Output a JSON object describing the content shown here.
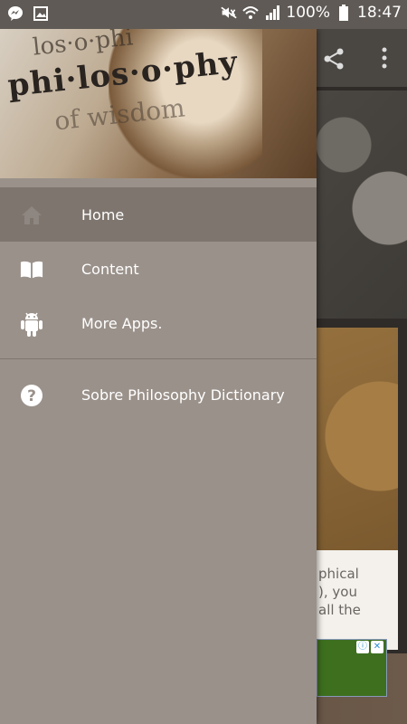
{
  "status_bar": {
    "battery": "100%",
    "time": "18:47",
    "left_icons": [
      "messenger-icon",
      "gallery-icon"
    ],
    "right_icons": [
      "mute-icon",
      "wifi-icon",
      "signal-icon",
      "battery-icon"
    ]
  },
  "background_app": {
    "text_fragment": "phical\n), you\nall the",
    "ad_badges": [
      "ⓘ",
      "✕"
    ]
  },
  "drawer": {
    "header_text_main": "phi·los·o·phy",
    "header_text_top": "los·o·phi",
    "header_text_bottom": "of wisdom",
    "menu": [
      {
        "label": "Home",
        "icon": "home-icon",
        "active": true
      },
      {
        "label": "Content",
        "icon": "book-icon",
        "active": false
      },
      {
        "label": "More Apps.",
        "icon": "android-icon",
        "active": false
      }
    ],
    "about": {
      "label": "Sobre Philosophy Dictionary",
      "icon": "help-icon"
    }
  },
  "colors": {
    "drawer_bg": "#9a918a",
    "active_item_bg": "#7e756e",
    "status_bar_bg": "#5f5a55"
  }
}
